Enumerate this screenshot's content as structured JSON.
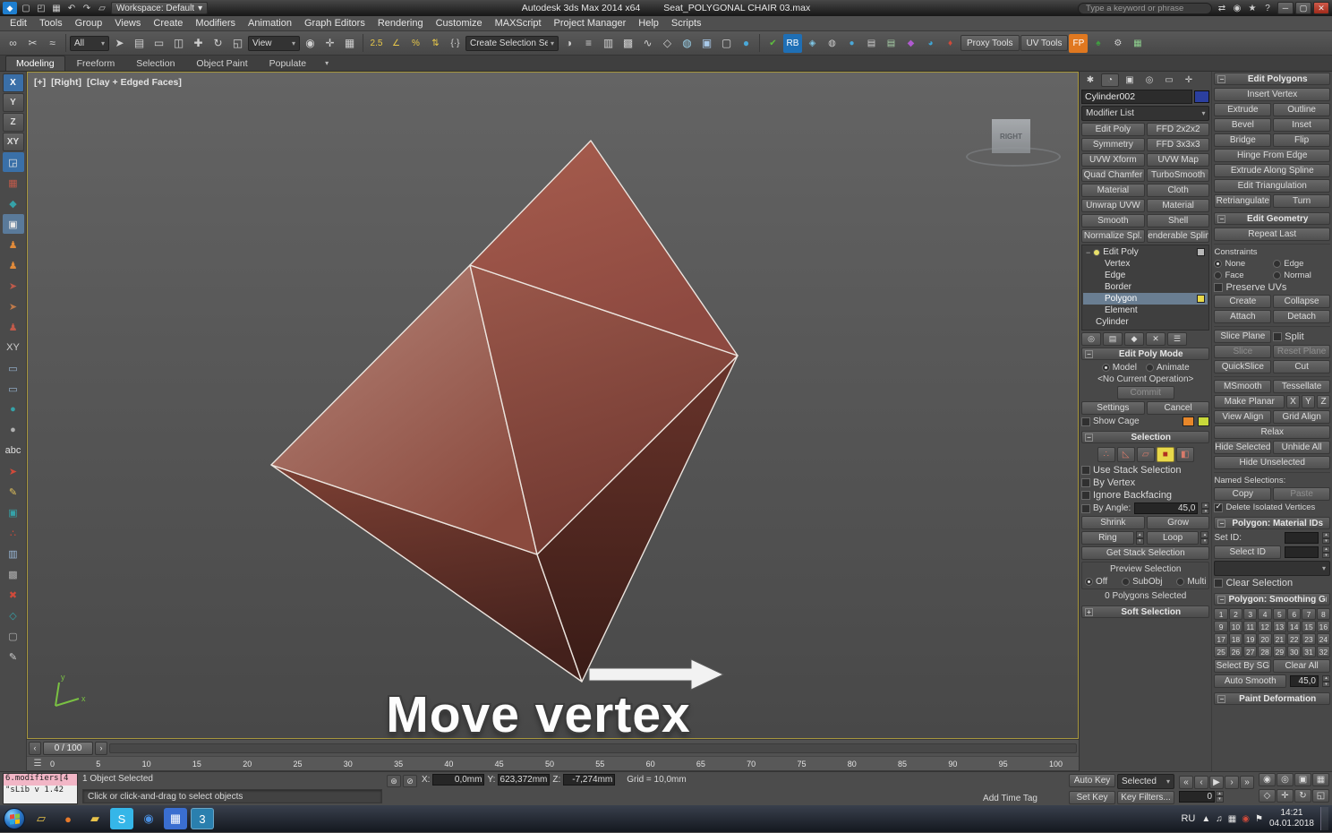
{
  "ui": {
    "caret": "▾",
    "minus": "−",
    "plus": "+"
  },
  "titlebar": {
    "workspace": "Workspace: Default",
    "app_title": "Autodesk 3ds Max 2014 x64",
    "file_title": "Seat_POLYGONAL CHAIR 03.max",
    "search_placeholder": "Type a keyword or phrase",
    "logo_glyph": "◆",
    "icons": [
      {
        "n": "new-scene-icon",
        "g": "▢"
      },
      {
        "n": "open-file-icon",
        "g": "◰"
      },
      {
        "n": "save-file-icon",
        "g": "▦"
      },
      {
        "n": "undo-icon",
        "g": "↶"
      },
      {
        "n": "redo-icon",
        "g": "↷"
      },
      {
        "n": "project-folder-icon",
        "g": "▱"
      }
    ],
    "right_icons": [
      {
        "n": "sign-in-icon",
        "g": "⇄"
      },
      {
        "n": "search-icon",
        "g": "◉"
      },
      {
        "n": "favorites-star-icon",
        "g": "★"
      },
      {
        "n": "help-icon",
        "g": "?"
      }
    ],
    "window_buttons": [
      {
        "n": "minimize-button",
        "g": "─"
      },
      {
        "n": "maximize-button",
        "g": "▢"
      },
      {
        "n": "close-button",
        "g": "✕"
      }
    ]
  },
  "menubar": {
    "items": [
      "Edit",
      "Tools",
      "Group",
      "Views",
      "Create",
      "Modifiers",
      "Animation",
      "Graph Editors",
      "Rendering",
      "Customize",
      "MAXScript",
      "Project Manager",
      "Help",
      "Scripts"
    ]
  },
  "main_toolbar": {
    "filter_value": "All",
    "coord_value": "View",
    "selection_set_value": "Create Selection Set",
    "proxy_tools": "Proxy Tools",
    "uv_tools": "UV Tools",
    "g1": [
      {
        "n": "select-and-link-icon",
        "g": "∞"
      },
      {
        "n": "unlink-selection-icon",
        "g": "✂"
      },
      {
        "n": "bind-to-space-warp-icon",
        "g": "≈"
      }
    ],
    "g2": [
      {
        "n": "select-object-icon",
        "g": "➤"
      },
      {
        "n": "select-by-name-icon",
        "g": "▤"
      },
      {
        "n": "rectangular-selection-region-icon",
        "g": "▭"
      },
      {
        "n": "window-crossing-icon",
        "g": "◫"
      }
    ],
    "g3": [
      {
        "n": "select-and-move-icon",
        "g": "✚"
      },
      {
        "n": "select-and-rotate-icon",
        "g": "↻"
      },
      {
        "n": "select-and-scale-icon",
        "g": "◱"
      }
    ],
    "g4": [
      {
        "n": "use-pivot-point-center-icon",
        "g": "◉"
      },
      {
        "n": "select-and-manipulate-icon",
        "g": "✛"
      },
      {
        "n": "keyboard-shortcut-override-icon",
        "g": "▦"
      }
    ],
    "g5": [
      {
        "n": "snaps-toggle-icon",
        "g": "2.5",
        "c": "#e8c84a"
      },
      {
        "n": "angle-snap-icon",
        "g": "∠",
        "c": "#e8c84a"
      },
      {
        "n": "percent-snap-icon",
        "g": "%",
        "c": "#e8c84a"
      },
      {
        "n": "spinner-snap-icon",
        "g": "⇅",
        "c": "#e8c84a"
      }
    ],
    "g6": [
      {
        "n": "edit-named-selection-sets-icon",
        "g": "{·}"
      }
    ],
    "g7": [
      {
        "n": "mirror-icon",
        "g": "◑"
      },
      {
        "n": "align-icon",
        "g": "≡"
      },
      {
        "n": "layer-manager-icon",
        "g": "▥"
      },
      {
        "n": "graphite-ribbon-icon",
        "g": "▩"
      },
      {
        "n": "curve-editor-icon",
        "g": "∿"
      },
      {
        "n": "schematic-view-icon",
        "g": "◇"
      },
      {
        "n": "material-editor-icon",
        "g": "◍",
        "c": "#9ad0e8"
      },
      {
        "n": "render-setup-icon",
        "g": "▣",
        "c": "#a8c8e8"
      },
      {
        "n": "rendered-frame-icon",
        "g": "▢"
      },
      {
        "n": "render-production-icon",
        "g": "●",
        "c": "#4aa8d8"
      }
    ],
    "g8": [
      {
        "n": "xview-checks-icon",
        "g": "✔",
        "c": "#5fbf3f"
      },
      {
        "n": "rb-plugin-icon",
        "g": "RB",
        "c": "#ffffff",
        "bg": "#1f6fb5"
      },
      {
        "n": "diamond-plugin-icon",
        "g": "◈",
        "c": "#7fc8e8"
      },
      {
        "n": "sphere-plugin-icon",
        "g": "◍",
        "c": "#cfcfcf"
      },
      {
        "n": "drop-plugin-icon",
        "g": "●",
        "c": "#4aa8d8"
      },
      {
        "n": "database-plugin-icon",
        "g": "▤",
        "c": "#cfcfcf"
      },
      {
        "n": "database-arrow-plugin-icon",
        "g": "▤",
        "c": "#a8d0a8"
      },
      {
        "n": "gem-plugin-icon",
        "g": "◆",
        "c": "#b05ad0"
      },
      {
        "n": "teapot-plugin-icon",
        "g": "◕",
        "c": "#3fa8d8"
      },
      {
        "n": "pin-plugin-icon",
        "g": "♦",
        "c": "#d04a3a"
      }
    ],
    "g10": [
      {
        "n": "fp-plugin-icon",
        "g": "FP",
        "c": "#ffffff",
        "bg": "#e07820"
      },
      {
        "n": "tree-plugin-icon",
        "g": "♠",
        "c": "#3f9f3f"
      },
      {
        "n": "wrench-icon",
        "g": "⚙",
        "c": "#cfcfcf"
      },
      {
        "n": "grid-icon",
        "g": "▦",
        "c": "#8fd08f"
      }
    ]
  },
  "ribbon": {
    "tabs": [
      "Modeling",
      "Freeform",
      "Selection",
      "Object Paint",
      "Populate"
    ]
  },
  "left_toolbar": {
    "axis": [
      "X",
      "Y",
      "Z",
      "XY"
    ],
    "icons": [
      {
        "n": "axis-xy-plane-icon",
        "g": "◲",
        "c": "#e8e8e8",
        "bg": "#3a70a8"
      },
      {
        "n": "script-grid-icon",
        "g": "▦",
        "c": "#c05a4a"
      },
      {
        "n": "script-teal-icon",
        "g": "◆",
        "c": "#35a2a8"
      },
      {
        "n": "script-active-tool-icon",
        "g": "▣",
        "c": "#e8e8e8",
        "bg": "#5a7a9a"
      },
      {
        "n": "script-person1-icon",
        "g": "♟",
        "c": "#e08a3a"
      },
      {
        "n": "script-person2-icon",
        "g": "♟",
        "c": "#e08a3a"
      },
      {
        "n": "script-arrow1-icon",
        "g": "➤",
        "c": "#c05a4a"
      },
      {
        "n": "script-arrow2-icon",
        "g": "➤",
        "c": "#c07a4a"
      },
      {
        "n": "script-person3-icon",
        "g": "♟",
        "c": "#c05a4a"
      },
      {
        "n": "script-xy-icon",
        "g": "XY",
        "c": "#cfcfcf"
      },
      {
        "n": "script-monitor1-icon",
        "g": "▭",
        "c": "#9ab8d8"
      },
      {
        "n": "script-monitor2-icon",
        "g": "▭",
        "c": "#9ab8d8"
      },
      {
        "n": "script-sphere1-icon",
        "g": "●",
        "c": "#35a2a8"
      },
      {
        "n": "script-sphere2-icon",
        "g": "●",
        "c": "#b0b0b0"
      },
      {
        "n": "script-abc-icon",
        "g": "abc",
        "c": "#e0e0e0"
      },
      {
        "n": "script-cursor-icon",
        "g": "➤",
        "c": "#d04a3a"
      },
      {
        "n": "script-pencil-icon",
        "g": "✎",
        "c": "#e0c05a"
      },
      {
        "n": "script-box-icon",
        "g": "▣",
        "c": "#35a2a8"
      },
      {
        "n": "script-dots-icon",
        "g": "∴",
        "c": "#d04a3a"
      },
      {
        "n": "script-chart-icon",
        "g": "▥",
        "c": "#9ab8d8"
      },
      {
        "n": "script-checker-icon",
        "g": "▩",
        "c": "#b0b0b0"
      },
      {
        "n": "script-close-icon",
        "g": "✖",
        "c": "#d04a3a"
      },
      {
        "n": "script-teal2-icon",
        "g": "◇",
        "c": "#35a2a8"
      },
      {
        "n": "script-gray-icon",
        "g": "▢",
        "c": "#b0b0b0"
      },
      {
        "n": "script-dropper-icon",
        "g": "✎",
        "c": "#cfcfcf"
      }
    ]
  },
  "viewport": {
    "label_plus": "[+]",
    "label_view": "[Right]",
    "label_shading": "[Clay + Edged Faces]",
    "viewcube": "RIGHT",
    "overlay": "Move vertex"
  },
  "panel": {
    "tabs": [
      {
        "n": "create-tab-icon",
        "g": "✱"
      },
      {
        "n": "modify-tab-icon",
        "g": "◔"
      },
      {
        "n": "hierarchy-tab-icon",
        "g": "▣"
      },
      {
        "n": "motion-tab-icon",
        "g": "◎"
      },
      {
        "n": "display-tab-icon",
        "g": "▭"
      },
      {
        "n": "utilities-tab-icon",
        "g": "✛"
      }
    ],
    "object_name": "Cylinder002",
    "modifier_list": "Modifier List",
    "modifier_buttons": [
      "Edit Poly",
      "FFD 2x2x2",
      "Symmetry",
      "FFD 3x3x3",
      "UVW Xform",
      "UVW Map",
      "Quad Chamfer",
      "TurboSmooth",
      "Material",
      "Cloth",
      "Unwrap UVW",
      "Material",
      "Smooth",
      "Shell",
      "Normalize Spl.",
      "Renderable Spline"
    ],
    "stack": {
      "modifier": "Edit Poly",
      "children": [
        "Vertex",
        "Edge",
        "Border",
        "Polygon",
        "Element"
      ],
      "base": "Cylinder"
    },
    "stack_tools": [
      {
        "n": "pin-stack-icon",
        "g": "◎"
      },
      {
        "n": "show-end-result-icon",
        "g": "▤"
      },
      {
        "n": "make-unique-icon",
        "g": "◆"
      },
      {
        "n": "remove-modifier-icon",
        "g": "✕"
      },
      {
        "n": "configure-modifier-sets-icon",
        "g": "☰"
      }
    ],
    "edit_poly_mode": {
      "title": "Edit Poly Mode",
      "model": "Model",
      "animate": "Animate",
      "current_op": "<No Current Operation>",
      "commit": "Commit",
      "settings": "Settings",
      "cancel": "Cancel",
      "show_cage": "Show Cage"
    },
    "selection": {
      "title": "Selection",
      "subobj": [
        {
          "n": "vertex-subobject-icon",
          "g": "∴"
        },
        {
          "n": "edge-subobject-icon",
          "g": "◺"
        },
        {
          "n": "border-subobject-icon",
          "g": "▱"
        },
        {
          "n": "polygon-subobject-icon",
          "g": "■"
        },
        {
          "n": "element-subobject-icon",
          "g": "◧"
        }
      ],
      "use_stack_selection": "Use Stack Selection",
      "by_vertex": "By Vertex",
      "ignore_backfacing": "Ignore Backfacing",
      "by_angle": "By Angle:",
      "by_angle_value": "45,0",
      "shrink": "Shrink",
      "grow": "Grow",
      "ring": "Ring",
      "loop": "Loop",
      "get_stack_selection": "Get Stack Selection",
      "preview_selection": "Preview Selection",
      "off": "Off",
      "subobj_lbl": "SubObj",
      "multi": "Multi",
      "status": "0 Polygons Selected"
    },
    "soft_selection": {
      "title": "Soft Selection"
    },
    "edit_polygons": {
      "title": "Edit Polygons",
      "insert_vertex": "Insert Vertex",
      "extrude": "Extrude",
      "outline": "Outline",
      "bevel": "Bevel",
      "inset": "Inset",
      "bridge": "Bridge",
      "flip": "Flip",
      "hinge_from_edge": "Hinge From Edge",
      "extrude_along_spline": "Extrude Along Spline",
      "edit_triangulation": "Edit Triangulation",
      "retriangulate": "Retriangulate",
      "turn": "Turn"
    },
    "edit_geometry": {
      "title": "Edit Geometry",
      "repeat_last": "Repeat Last",
      "constraints": "Constraints",
      "none": "None",
      "edge": "Edge",
      "face": "Face",
      "normal": "Normal",
      "preserve_uvs": "Preserve UVs",
      "create": "Create",
      "collapse": "Collapse",
      "attach": "Attach",
      "detach": "Detach",
      "slice_plane": "Slice Plane",
      "split": "Split",
      "slice": "Slice",
      "reset_plane": "Reset Plane",
      "quickslice": "QuickSlice",
      "cut": "Cut",
      "msmooth": "MSmooth",
      "tessellate": "Tessellate",
      "make_planar": "Make Planar",
      "x": "X",
      "y": "Y",
      "z": "Z",
      "view_align": "View Align",
      "grid_align": "Grid Align",
      "relax": "Relax",
      "hide_selected": "Hide Selected",
      "unhide_all": "Unhide All",
      "hide_unselected": "Hide Unselected",
      "named_selections": "Named Selections:",
      "copy": "Copy",
      "paste": "Paste",
      "delete_isolated": "Delete Isolated Vertices"
    },
    "material_ids": {
      "title": "Polygon: Material IDs",
      "set_id": "Set ID:",
      "select_id": "Select ID",
      "clear_selection": "Clear Selection"
    },
    "smoothing": {
      "title": "Polygon: Smoothing Groups",
      "numbers": [
        "1",
        "2",
        "3",
        "4",
        "5",
        "6",
        "7",
        "8",
        "9",
        "10",
        "11",
        "12",
        "13",
        "14",
        "15",
        "16",
        "17",
        "18",
        "19",
        "20",
        "21",
        "22",
        "23",
        "24",
        "25",
        "26",
        "27",
        "28",
        "29",
        "30",
        "31",
        "32"
      ],
      "select_by_sg": "Select By SG",
      "clear_all": "Clear All",
      "auto_smooth": "Auto Smooth",
      "auto_smooth_value": "45,0"
    },
    "paint_deformation": {
      "title": "Paint Deformation"
    }
  },
  "timeline": {
    "slider": "0 / 100",
    "ticks": [
      "0",
      "5",
      "10",
      "15",
      "20",
      "25",
      "30",
      "35",
      "40",
      "45",
      "50",
      "55",
      "60",
      "65",
      "70",
      "75",
      "80",
      "85",
      "90",
      "95",
      "100"
    ]
  },
  "statusbar": {
    "listener_line1": "6.modifiers[4",
    "listener_line2": "\"sLib v 1.42",
    "selection_status": "1 Object Selected",
    "prompt": "Click or click-and-drag to select objects",
    "x": "X:",
    "y": "Y:",
    "z": "Z:",
    "x_value": "0,0mm",
    "y_value": "623,372mm",
    "z_value": "-7,274mm",
    "grid": "Grid = 10,0mm",
    "add_time_tag": "Add Time Tag",
    "auto_key": "Auto Key",
    "set_key": "Set Key",
    "key_mode": "Selected",
    "key_filters": "Key Filters...",
    "time_value": "0",
    "lock_icons": [
      {
        "n": "isolate-selection-icon",
        "g": "⊛"
      },
      {
        "n": "selection-lock-icon",
        "g": "⊘"
      }
    ],
    "playback": [
      {
        "n": "go-to-start-button",
        "g": "«"
      },
      {
        "n": "previous-frame-button",
        "g": "‹"
      },
      {
        "n": "play-button",
        "g": "▶"
      },
      {
        "n": "next-frame-button",
        "g": "›"
      },
      {
        "n": "go-to-end-button",
        "g": "»"
      }
    ],
    "nav": [
      {
        "n": "zoom-icon",
        "g": "◉"
      },
      {
        "n": "zoom-all-icon",
        "g": "◎"
      },
      {
        "n": "zoom-extents-icon",
        "g": "▣"
      },
      {
        "n": "zoom-extents-all-icon",
        "g": "▦"
      },
      {
        "n": "field-of-view-icon",
        "g": "◇"
      },
      {
        "n": "pan-icon",
        "g": "✛"
      },
      {
        "n": "orbit-icon",
        "g": "↻"
      },
      {
        "n": "maximize-viewport-icon",
        "g": "◱"
      }
    ]
  },
  "taskbar": {
    "lang": "RU",
    "time": "14:21",
    "date": "04.01.2018",
    "apps": [
      {
        "n": "taskbar-explorer-icon",
        "g": "▱",
        "c": "#e8c34a"
      },
      {
        "n": "taskbar-browser-icon",
        "g": "●",
        "c": "#e87a2a"
      },
      {
        "n": "taskbar-folder-icon",
        "g": "▰",
        "c": "#e8c34a"
      },
      {
        "n": "taskbar-skype-icon",
        "g": "S",
        "c": "#ffffff",
        "bg": "#35b6e8"
      },
      {
        "n": "taskbar-chrome-icon",
        "g": "◉",
        "c": "#4a90e2"
      },
      {
        "n": "taskbar-capture-app-icon",
        "g": "▦",
        "c": "#ffffff",
        "bg": "#3a6ed0"
      },
      {
        "n": "taskbar-3dsmax-icon",
        "g": "3",
        "c": "#ffffff",
        "bg": "#2a7fae"
      }
    ],
    "tray": [
      {
        "n": "hidden-icons-chevron-icon",
        "g": "▲"
      },
      {
        "n": "volume-icon",
        "g": "♫"
      },
      {
        "n": "network-icon",
        "g": "▦"
      },
      {
        "n": "antivirus-icon",
        "g": "◉",
        "c": "#d04a3a"
      },
      {
        "n": "flag-icon",
        "g": "⚑"
      }
    ]
  }
}
